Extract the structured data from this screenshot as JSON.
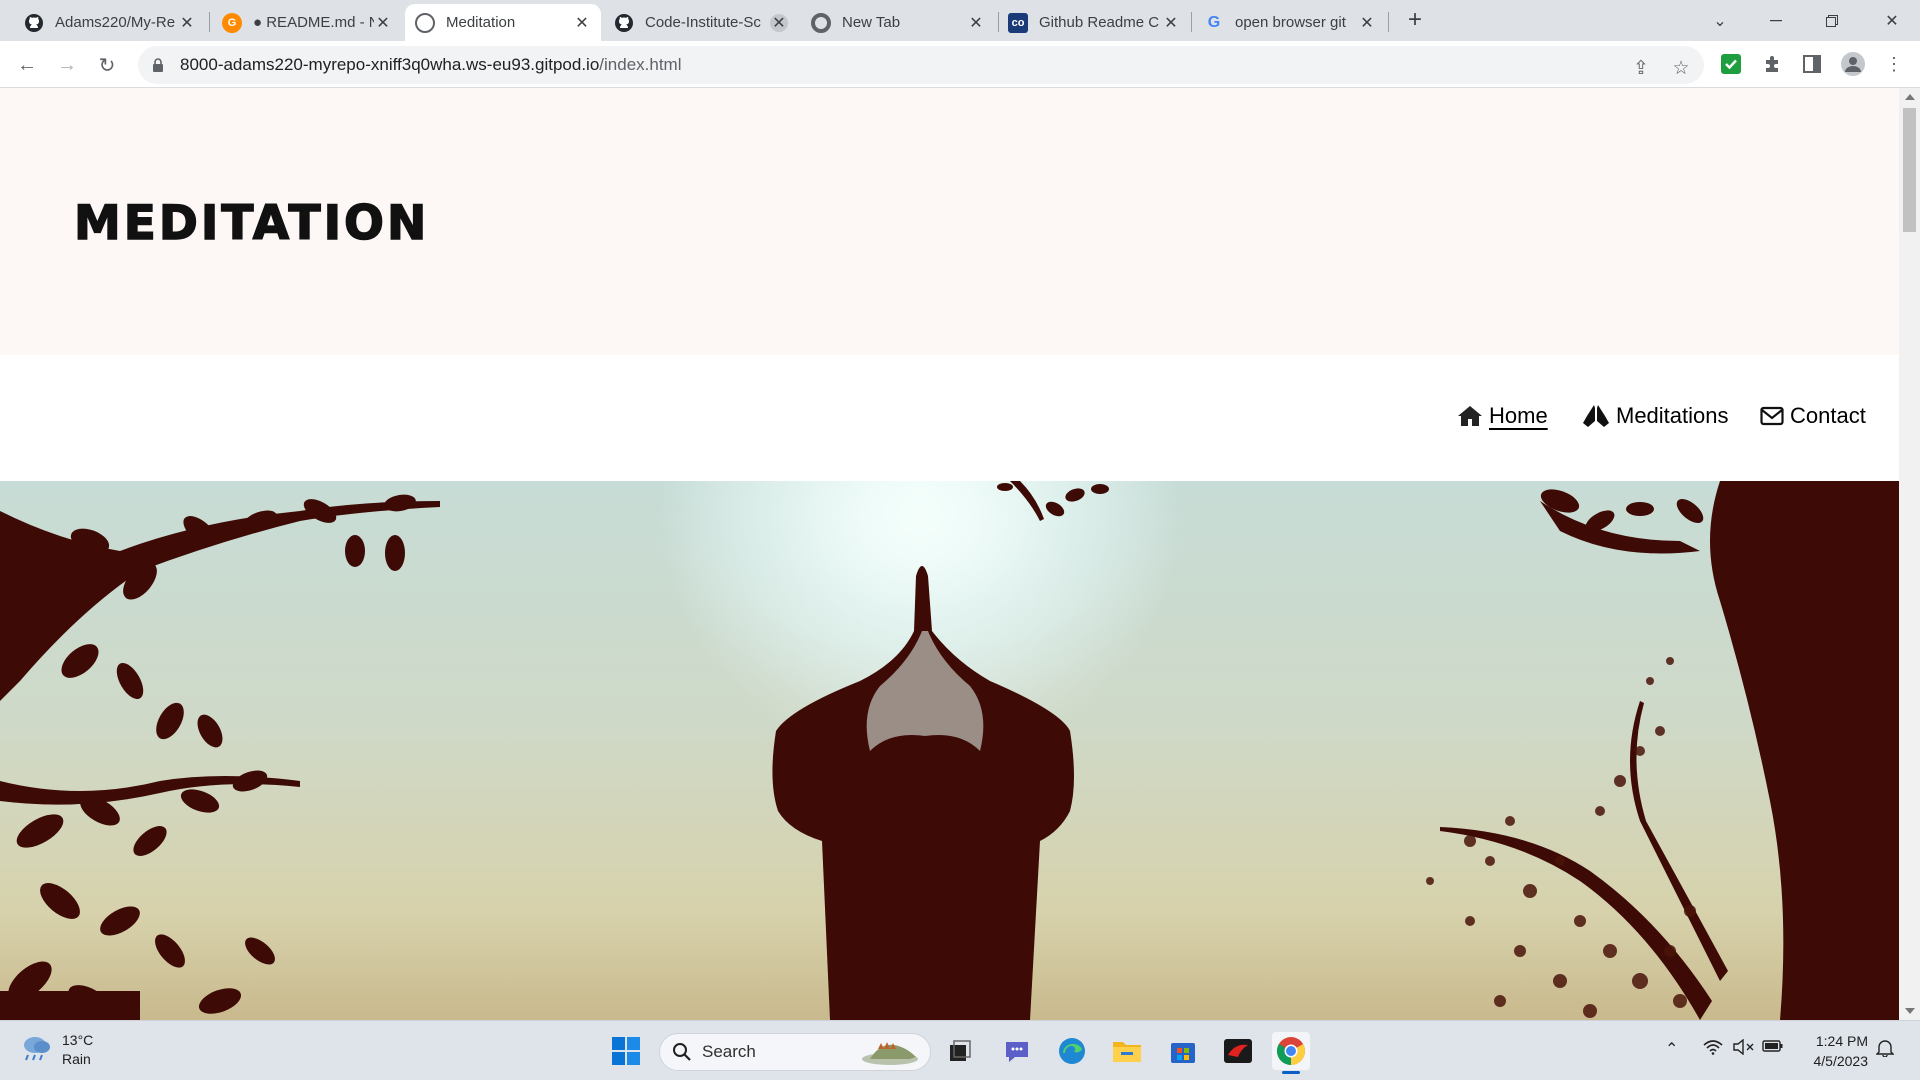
{
  "browser": {
    "tabs": [
      {
        "title": "Adams220/My-Re",
        "icon": "github-icon",
        "active": false
      },
      {
        "title": "● README.md - N",
        "icon": "gitpod-icon",
        "active": false
      },
      {
        "title": "Meditation",
        "icon": "globe-icon",
        "active": true
      },
      {
        "title": "Code-Institute-Sc",
        "icon": "github-icon",
        "active": false
      },
      {
        "title": "New Tab",
        "icon": "chrome-icon",
        "active": false
      },
      {
        "title": "Github Readme C",
        "icon": "codeanywhere-icon",
        "active": false
      },
      {
        "title": "open browser git",
        "icon": "google-icon",
        "active": false
      }
    ],
    "address": {
      "host": "8000-adams220-myrepo-xniff3q0wha.ws-eu93.gitpod.io",
      "path": "/index.html"
    }
  },
  "site": {
    "logo": "MEDITATION",
    "nav": [
      {
        "label": "Home",
        "icon": "home-icon",
        "active": true
      },
      {
        "label": "Meditations",
        "icon": "praying-hands-icon",
        "active": false
      },
      {
        "label": "Contact",
        "icon": "envelope-icon",
        "active": false
      }
    ],
    "hero_image": "silhouette of person meditating with hands raised between trees"
  },
  "taskbar": {
    "weather": {
      "temp": "13°C",
      "condition": "Rain"
    },
    "search_label": "Search",
    "time": "1:24 PM",
    "date": "4/5/2023"
  },
  "colors": {
    "header_band": "#fdf7f6",
    "silhouette": "#3d0a05",
    "tab_strip": "#dee1e6"
  }
}
